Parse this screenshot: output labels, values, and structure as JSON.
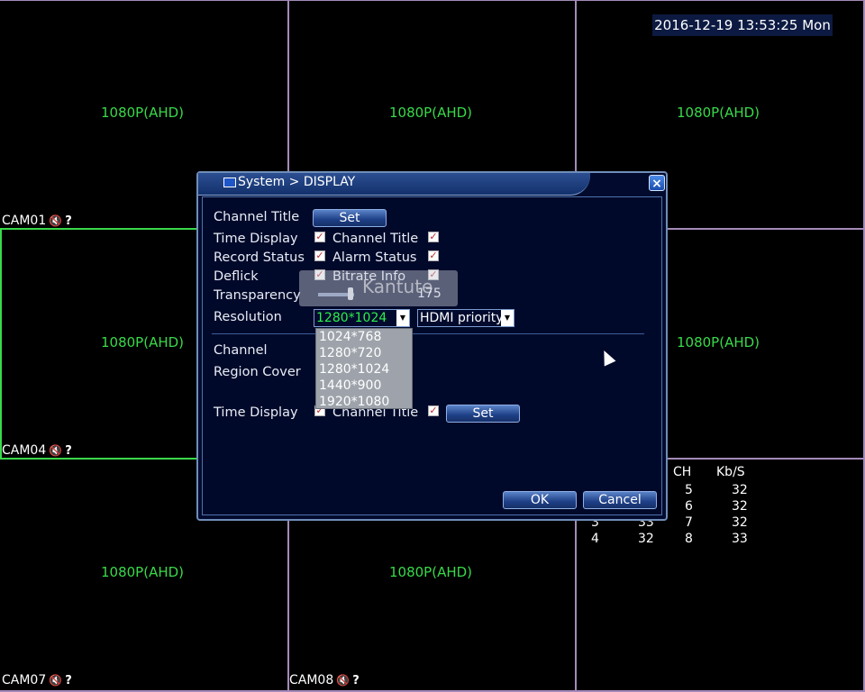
{
  "datetime": "2016-12-19 13:53:25 Mon",
  "grid": {
    "resolutions": [
      "1080P(AHD)",
      "1080P(AHD)",
      "1080P(AHD)",
      "1080P(AHD)",
      "1080P(AHD)",
      "1080P(AHD)",
      "1080P(AHD)",
      "1080P(AHD)"
    ],
    "cameras": [
      "CAM01",
      "CAM04",
      "CAM07",
      "CAM08"
    ],
    "status_icons": [
      "speaker-muted-icon",
      "help-question-icon"
    ]
  },
  "bitrate": {
    "headers": [
      "CH",
      "Kb/S"
    ],
    "rows": [
      {
        "ch": "",
        "kbs": "",
        "ch2": "5",
        "kbs2": "32"
      },
      {
        "ch": "",
        "kbs": "",
        "ch2": "6",
        "kbs2": "32"
      },
      {
        "ch": "3",
        "kbs": "33",
        "ch2": "7",
        "kbs2": "32"
      },
      {
        "ch": "4",
        "kbs": "32",
        "ch2": "8",
        "kbs2": "33"
      }
    ]
  },
  "dialog": {
    "title": "System > DISPLAY",
    "close_label": "×",
    "labels": {
      "channel_title": "Channel Title",
      "time_display": "Time Display",
      "channel_title_cb": "Channel Title",
      "record_status": "Record Status",
      "alarm_status": "Alarm Status",
      "deflick": "Deflick",
      "bitrate_info": "Bitrate Info",
      "transparency": "Transparency",
      "resolution": "Resolution",
      "channel": "Channel",
      "region_cover": "Region Cover",
      "time_display2": "Time Display",
      "channel_title2": "Channel Title"
    },
    "set_label": "Set",
    "set2_label": "Set",
    "ok_label": "OK",
    "cancel_label": "Cancel",
    "transparency_value": "175",
    "resolution_value": "1280*1024",
    "hdmi_value": "HDMI priority",
    "resolution_options": [
      "1024*768",
      "1280*720",
      "1280*1024",
      "1440*900",
      "1920*1080"
    ],
    "checkmark": "✓"
  },
  "watermark_text": "Kantute"
}
